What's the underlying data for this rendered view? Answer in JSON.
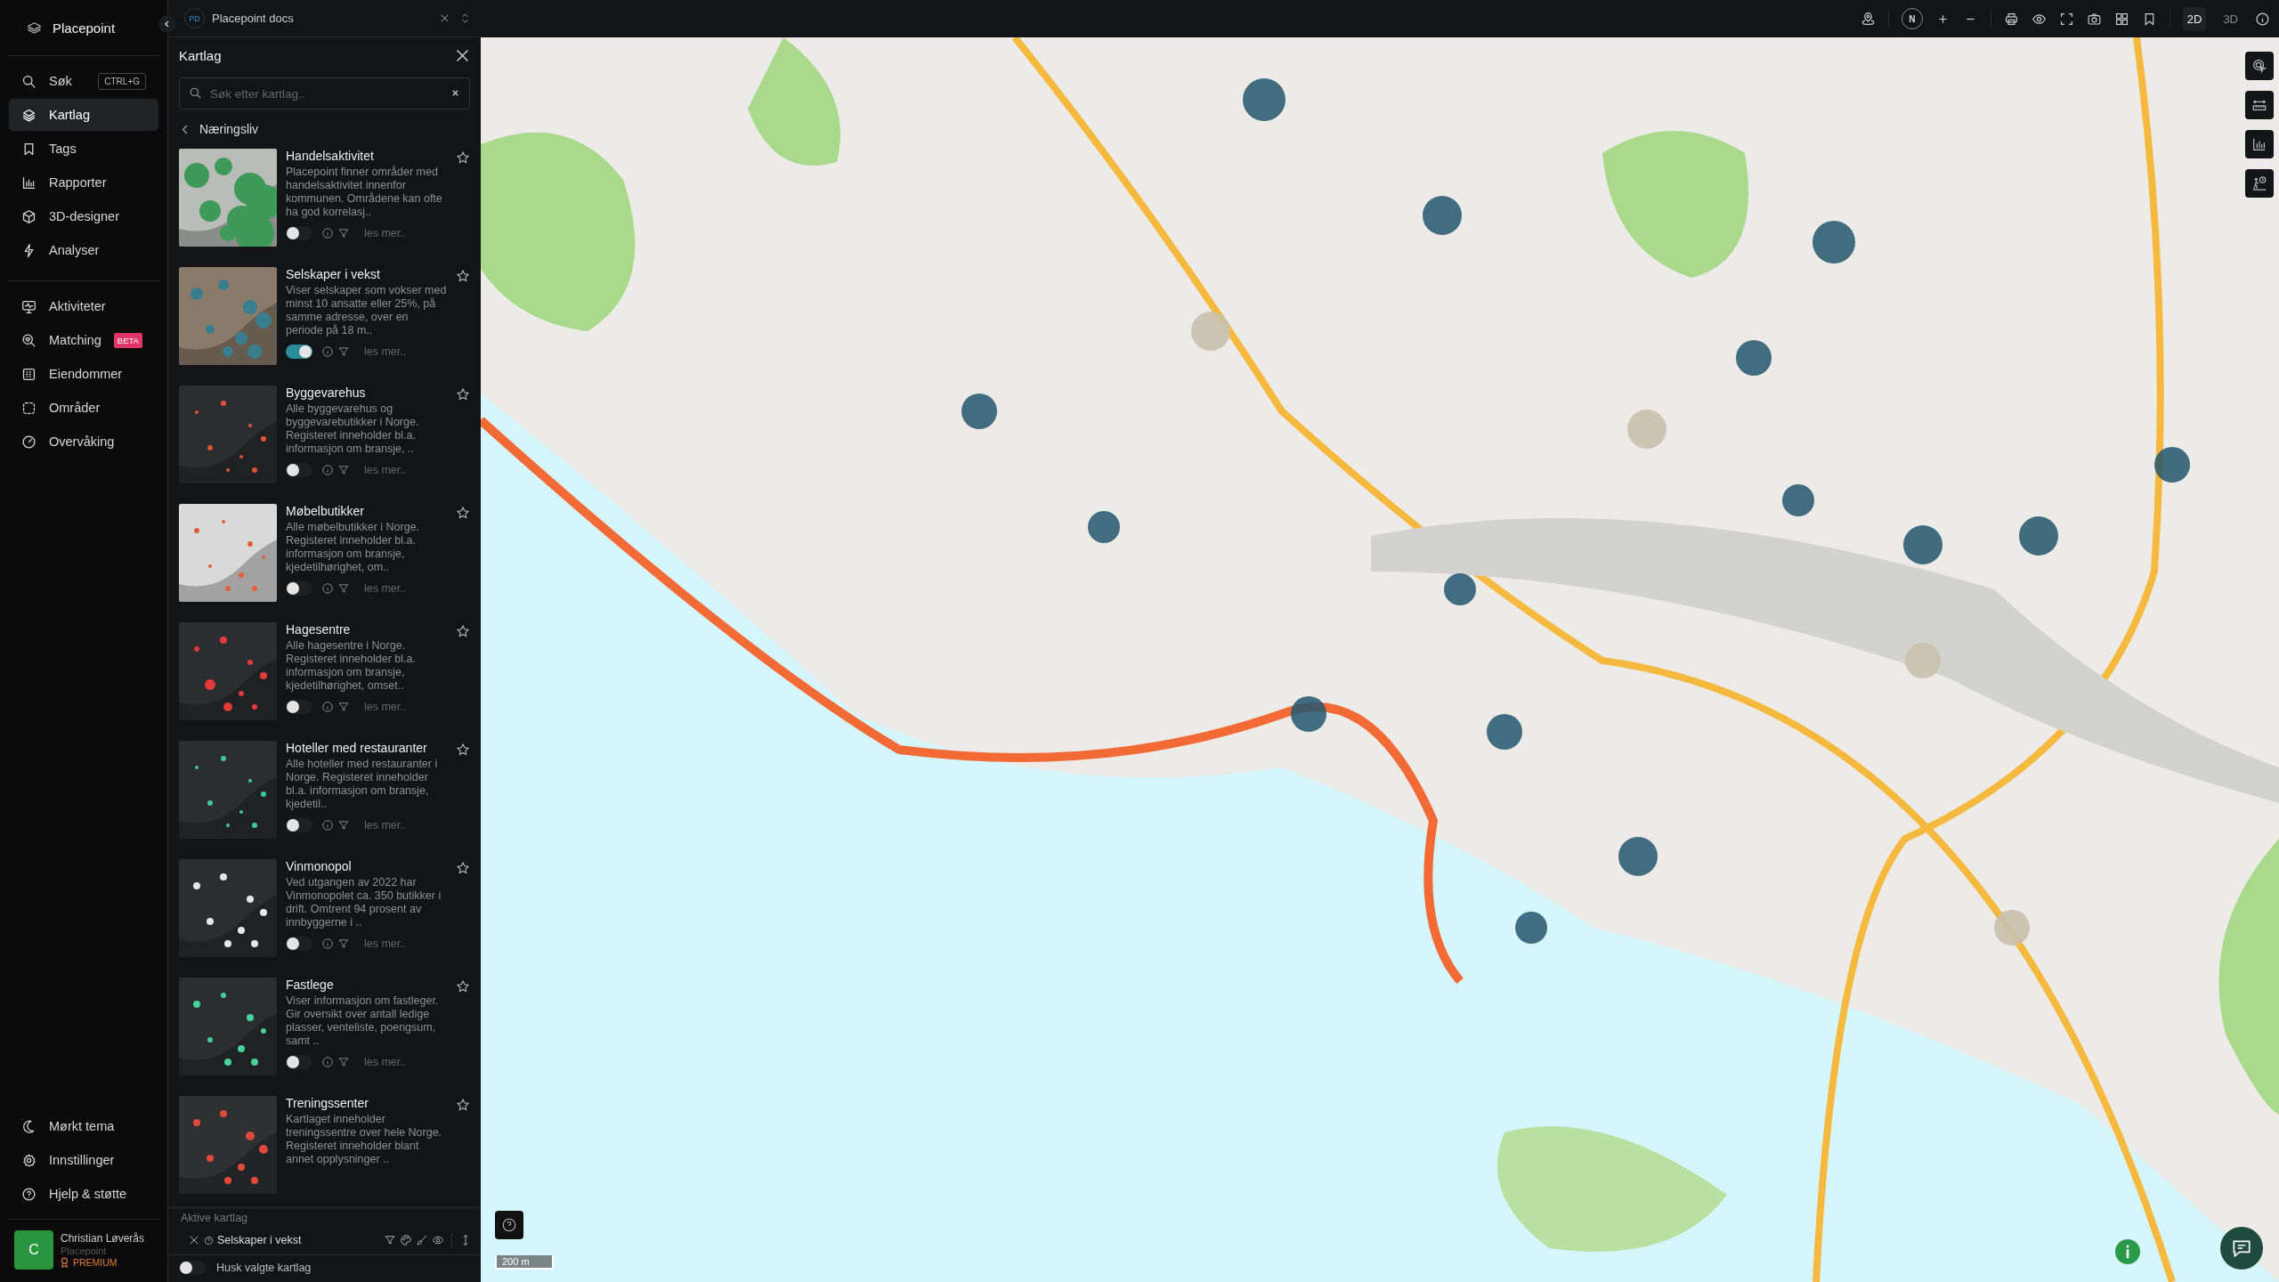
{
  "app": {
    "name": "Placepoint"
  },
  "nav": {
    "items": [
      {
        "label": "Søk",
        "shortcut": "CTRL+G",
        "selected": false
      },
      {
        "label": "Kartlag",
        "selected": true
      },
      {
        "label": "Tags",
        "selected": false
      },
      {
        "label": "Rapporter",
        "selected": false
      },
      {
        "label": "3D-designer",
        "selected": false
      },
      {
        "label": "Analyser",
        "selected": false
      }
    ],
    "items2": [
      {
        "label": "Aktiviteter",
        "selected": false
      },
      {
        "label": "Matching",
        "badge": "BETA",
        "selected": false
      },
      {
        "label": "Eiendommer",
        "selected": false
      },
      {
        "label": "Områder",
        "selected": false
      },
      {
        "label": "Overvåking",
        "selected": false
      }
    ],
    "bottom": [
      {
        "label": "Mørkt tema"
      },
      {
        "label": "Innstillinger"
      },
      {
        "label": "Hjelp & støtte"
      }
    ]
  },
  "user": {
    "initial": "C",
    "name": "Christian Løverås",
    "org": "Placepoint",
    "plan": "PREMIUM"
  },
  "workspace": {
    "initials": "PD",
    "title": "Placepoint docs"
  },
  "panel": {
    "title": "Kartlag",
    "search": {
      "placeholder": "Søk etter kartlag.."
    },
    "category": "Næringsliv",
    "layers": [
      {
        "title": "Handelsaktivitet",
        "description": "Placepoint finner områder med handelsaktivitet innenfor kommunen. Områdene kan ofte ha god korrelasj..",
        "on": false,
        "more": "les mer.."
      },
      {
        "title": "Selskaper i vekst",
        "description": "Viser selskaper som vokser med minst 10 ansatte eller 25%, på samme adresse, over en periode på 18 m..",
        "on": true,
        "more": "les mer.."
      },
      {
        "title": "Byggevarehus",
        "description": "Alle byggevarehus og byggevarebutikker i Norge. Registeret inneholder bl.a. informasjon om bransje, ..",
        "on": false,
        "more": "les mer.."
      },
      {
        "title": "Møbelbutikker",
        "description": "Alle møbelbutikker i Norge. Registeret inneholder bl.a. informasjon om bransje, kjedetilhørighet, om..",
        "on": false,
        "more": "les mer.."
      },
      {
        "title": "Hagesentre",
        "description": "Alle hagesentre i Norge. Registeret inneholder bl.a. informasjon om bransje, kjedetilhørighet, omset..",
        "on": false,
        "more": "les mer.."
      },
      {
        "title": "Hoteller med restauranter",
        "description": "Alle hoteller med restauranter i Norge. Registeret inneholder bl.a. informasjon om bransje, kjedetil..",
        "on": false,
        "more": "les mer.."
      },
      {
        "title": "Vinmonopol",
        "description": "Ved utgangen av 2022 har Vinmonopolet ca. 350 butikker i drift. Omtrent 94 prosent av innbyggerne i ..",
        "on": false,
        "more": "les mer.."
      },
      {
        "title": "Fastlege",
        "description": "Viser informasjon om fastleger. Gir oversikt over antall ledige plasser, venteliste, poengsum, samt ..",
        "on": false,
        "more": "les mer.."
      },
      {
        "title": "Treningssenter",
        "description": "Kartlaget inneholder treningssentre over hele Norge. Registeret inneholder blant annet opplysninger .."
      }
    ],
    "active": {
      "title": "Aktive kartlag",
      "layers": [
        {
          "name": "Selskaper i vekst"
        }
      ],
      "remember": {
        "label": "Husk valgte kartlag",
        "on": false
      }
    }
  },
  "map": {
    "compass": "N",
    "view_modes": [
      {
        "label": "2D",
        "selected": true
      },
      {
        "label": "3D",
        "selected": false
      }
    ],
    "scale": "200 m"
  }
}
